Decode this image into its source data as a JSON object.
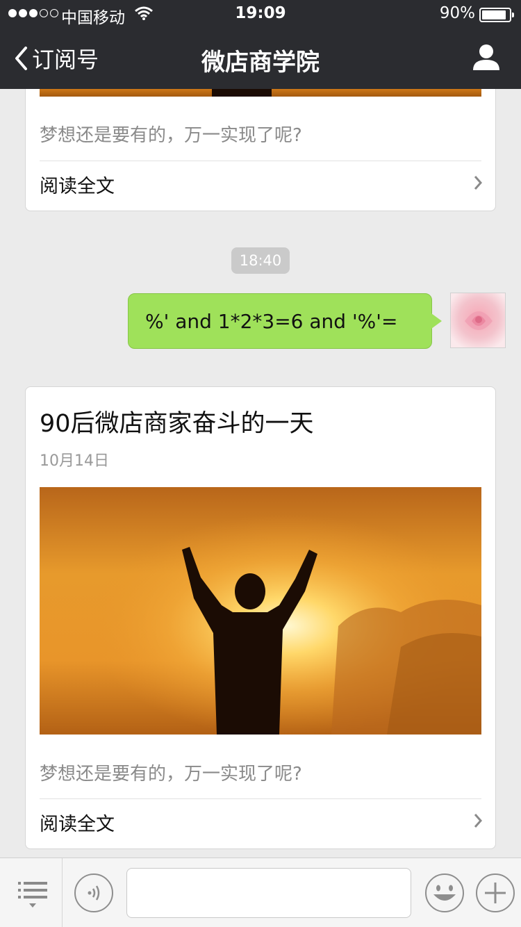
{
  "status_bar": {
    "carrier": "中国移动",
    "time": "19:09",
    "battery": "90%",
    "battery_level": 0.9,
    "signal_bars": 3
  },
  "nav": {
    "back_label": "订阅号",
    "title": "微店商学院",
    "profile_icon": "person-icon"
  },
  "card_top": {
    "excerpt": "梦想还是要有的，万一实现了呢?",
    "read_more": "阅读全文"
  },
  "timestamp": "18:40",
  "message": {
    "text": "%' and 1*2*3=6 and '%'=",
    "bubble_color": "#9fe15a"
  },
  "card_article": {
    "title": "90后微店商家奋斗的一天",
    "date": "10月14日",
    "excerpt": "梦想还是要有的，万一实现了呢?",
    "read_more": "阅读全文"
  },
  "bottom_bar": {
    "menu_icon": "menu-list-icon",
    "voice_icon": "voice-icon",
    "input_value": "",
    "emoji_icon": "emoji-icon",
    "plus_icon": "plus-icon"
  }
}
